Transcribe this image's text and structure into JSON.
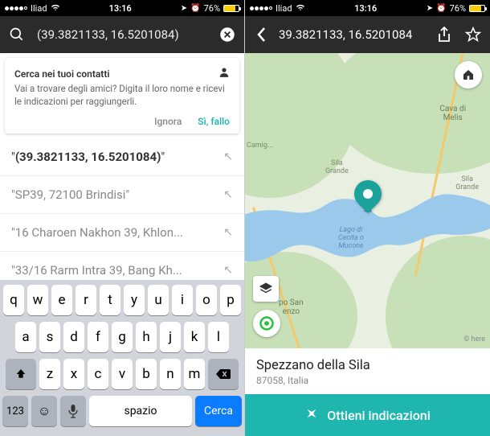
{
  "statusbar": {
    "carrier": "Iliad",
    "time": "13:16",
    "battery_pct": "76%"
  },
  "left": {
    "search_value": "(39.3821133, 16.5201084)",
    "contacts_card": {
      "title": "Cerca nei tuoi contatti",
      "desc": "Vai a trovare degli amici? Digita il loro nome e ricevi le indicazioni per raggiungerli.",
      "ignore": "Ignora",
      "accept": "Sì, fallo"
    },
    "results": [
      {
        "text_prefix": "\"",
        "text_bold": "(39.3821133, 16.5201084)",
        "text_suffix": "\""
      },
      {
        "text": "\"SP39, 72100 Brindisi\""
      },
      {
        "text": "\"16 Charoen Nakhon 39, Khlon..."
      },
      {
        "text": "\"33/16 Rarm Intra 39, Bang Kh..."
      }
    ],
    "keyboard": {
      "row1": [
        "q",
        "w",
        "e",
        "r",
        "t",
        "y",
        "u",
        "i",
        "o",
        "p"
      ],
      "row2": [
        "a",
        "s",
        "d",
        "f",
        "g",
        "h",
        "j",
        "k",
        "l"
      ],
      "row3": [
        "z",
        "x",
        "c",
        "v",
        "b",
        "n",
        "m"
      ],
      "numbers_key": "123",
      "space": "spazio",
      "action": "Cerca"
    }
  },
  "right": {
    "title": "39.3821133, 16.5201084",
    "map_labels": {
      "cava": "Cava di\nMelis",
      "sila1": "Sila\nGrande",
      "sila2": "Sila\nGrande",
      "lake": "Lago di\nCecita o\nMucone",
      "town": "po San\nenzo",
      "camig": "Camig..."
    },
    "credits": "here",
    "place": {
      "name": "Spezzano della Sila",
      "sub": "87058, Italia"
    },
    "cta": "Ottieni indicazioni"
  }
}
